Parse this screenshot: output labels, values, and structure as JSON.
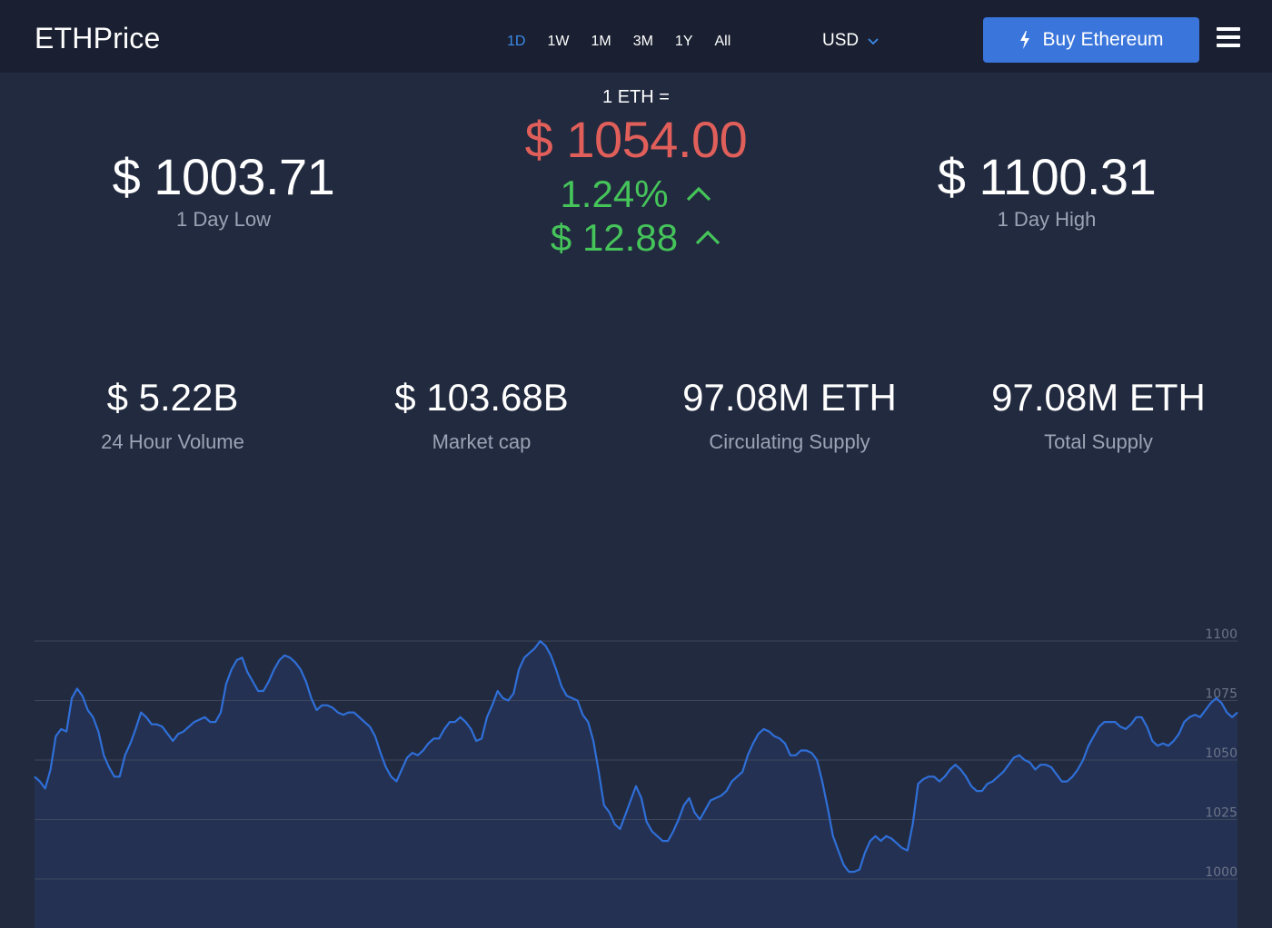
{
  "header": {
    "logo": "ETHPrice",
    "ranges": [
      "1D",
      "1W",
      "1M",
      "3M",
      "1Y",
      "All"
    ],
    "active_range": "1D",
    "currency": "USD",
    "buy_label": "Buy Ethereum"
  },
  "price": {
    "label": "1 ETH =",
    "current": "$ 1054.00",
    "change_pct": "1.24%",
    "change_abs": "$ 12.88",
    "low": "$ 1003.71",
    "low_label": "1 Day Low",
    "high": "$ 1100.31",
    "high_label": "1 Day High"
  },
  "metrics": [
    {
      "value": "$ 5.22B",
      "label": "24 Hour Volume"
    },
    {
      "value": "$ 103.68B",
      "label": "Market cap"
    },
    {
      "value": "97.08M ETH",
      "label": "Circulating Supply"
    },
    {
      "value": "97.08M ETH",
      "label": "Total Supply"
    }
  ],
  "colors": {
    "background": "#222a3f",
    "header": "#1a2031",
    "accent_blue": "#3b8bea",
    "button_blue": "#3a75db",
    "price_red": "#e15f5a",
    "change_green": "#45c45a",
    "chart_line": "#2f6fd8"
  },
  "chart_data": {
    "type": "area",
    "yticks": [
      "1100",
      "1075",
      "1050",
      "1025",
      "1000"
    ],
    "ylim": [
      975,
      1100
    ],
    "grid": true,
    "values": [
      1043,
      1041,
      1038,
      1046,
      1060,
      1063,
      1062,
      1076,
      1080,
      1077,
      1071,
      1068,
      1062,
      1052,
      1047,
      1043,
      1043,
      1052,
      1057,
      1063,
      1070,
      1068,
      1065,
      1065,
      1064,
      1061,
      1058,
      1061,
      1062,
      1064,
      1066,
      1067,
      1068,
      1066,
      1066,
      1070,
      1082,
      1088,
      1092,
      1093,
      1087,
      1083,
      1079,
      1079,
      1083,
      1088,
      1092,
      1094,
      1093,
      1091,
      1088,
      1083,
      1076,
      1071,
      1073,
      1073,
      1072,
      1070,
      1069,
      1070,
      1070,
      1068,
      1066,
      1064,
      1060,
      1053,
      1047,
      1043,
      1041,
      1046,
      1051,
      1053,
      1052,
      1054,
      1057,
      1059,
      1059,
      1063,
      1066,
      1066,
      1068,
      1066,
      1063,
      1058,
      1059,
      1068,
      1073,
      1079,
      1076,
      1075,
      1078,
      1088,
      1093,
      1095,
      1097,
      1100,
      1098,
      1094,
      1088,
      1081,
      1077,
      1076,
      1075,
      1069,
      1066,
      1058,
      1045,
      1031,
      1028,
      1023,
      1021,
      1027,
      1033,
      1039,
      1034,
      1024,
      1020,
      1018,
      1016,
      1016,
      1020,
      1025,
      1031,
      1034,
      1028,
      1025,
      1029,
      1033,
      1034,
      1035,
      1037,
      1041,
      1043,
      1045,
      1052,
      1057,
      1061,
      1063,
      1062,
      1060,
      1059,
      1057,
      1052,
      1052,
      1054,
      1054,
      1053,
      1050,
      1041,
      1030,
      1018,
      1012,
      1006,
      1003,
      1003,
      1004,
      1011,
      1016,
      1018,
      1016,
      1018,
      1017,
      1015,
      1013,
      1012,
      1023,
      1040,
      1042,
      1043,
      1043,
      1041,
      1043,
      1046,
      1048,
      1046,
      1043,
      1039,
      1037,
      1037,
      1040,
      1041,
      1043,
      1045,
      1048,
      1051,
      1052,
      1050,
      1049,
      1046,
      1048,
      1048,
      1047,
      1044,
      1041,
      1041,
      1043,
      1046,
      1050,
      1056,
      1060,
      1064,
      1066,
      1066,
      1066,
      1064,
      1063,
      1065,
      1068,
      1068,
      1064,
      1058,
      1056,
      1057,
      1056,
      1058,
      1061,
      1066,
      1068,
      1069,
      1068,
      1071,
      1074,
      1076,
      1074,
      1070,
      1068,
      1070
    ]
  }
}
